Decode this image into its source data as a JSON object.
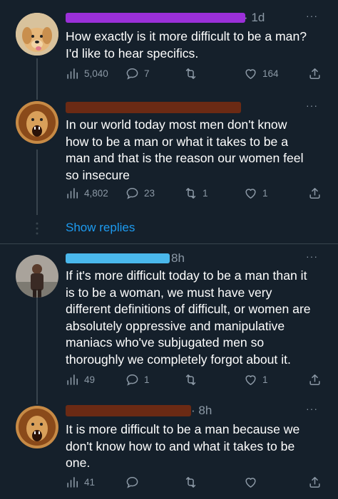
{
  "colors": {
    "background": "#15202b",
    "text": "#ffffff",
    "muted": "#8b98a5",
    "link": "#1d9bf0",
    "redact_purple": "#9b30d9",
    "redact_brown": "#6b2a14",
    "redact_blue": "#4ab8ec"
  },
  "tweets": [
    {
      "time": "· 1d",
      "text": "How exactly is it more difficult to be a man?\nI'd like to hear specifics.",
      "views": "5,040",
      "replies": "7",
      "retweets": "",
      "likes": "164",
      "avatar": "dog-avatar"
    },
    {
      "time": "",
      "text": "In our world today most men don't know\nhow to be a man or what it takes to be a\nman and that is the reason our women feel\nso insecure",
      "views": "4,802",
      "replies": "23",
      "retweets": "1",
      "likes": "1",
      "avatar": "lion-avatar"
    },
    {
      "time": "8h",
      "text": "If it's more difficult today to be a man than it\nis to be a woman, we must have very\ndifferent definitions of difficult, or women are\nabsolutely oppressive and manipulative\nmaniacs who've subjugated men so\nthoroughly we completely forgot about it.",
      "views": "49",
      "replies": "1",
      "retweets": "",
      "likes": "1",
      "avatar": "person-avatar"
    },
    {
      "time": "· 8h",
      "text": "It is more difficult to be a man because we\ndon't know how to and what it takes to be\none.",
      "views": "41",
      "replies": "",
      "retweets": "",
      "likes": "",
      "avatar": "lion-avatar"
    }
  ],
  "show_replies": "Show replies",
  "more_label": "···"
}
